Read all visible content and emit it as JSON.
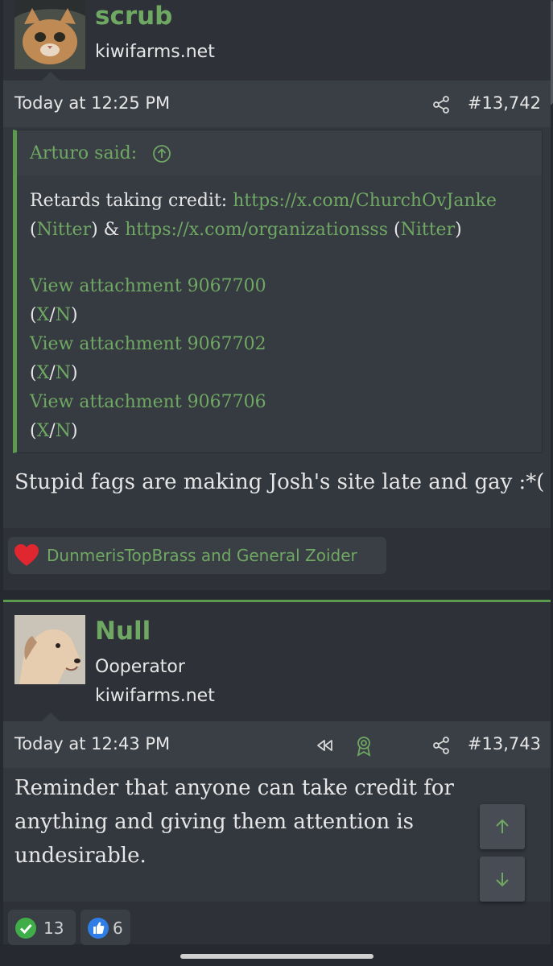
{
  "posts": [
    {
      "username": "scrub",
      "user_title": "kiwifarms.net",
      "date": "Today at 12:25 PM",
      "post_number": "#13,742",
      "quote": {
        "author": "Arturo said:",
        "line1_text": "Retards taking credit: ",
        "line1_link": "https://x.com/ChurchOvJanke",
        "line2_open": "(",
        "line2_nitter1": "Nitter",
        "line2_mid": ") & ",
        "line2_link": "https://x.com/organizationsss",
        "line2_open2": " (",
        "line2_nitter2": "Nitter",
        "line2_close": ")",
        "attachments": [
          {
            "label": "View attachment 9067700",
            "x": "X",
            "n": "N"
          },
          {
            "label": "View attachment 9067702",
            "x": "X",
            "n": "N"
          },
          {
            "label": "View attachment 9067706",
            "x": "X",
            "n": "N"
          }
        ]
      },
      "body": "Stupid fags are making Josh's site late and gay :*(",
      "reactions": "DunmerisTopBrass and General Zoider"
    },
    {
      "username": "Null",
      "user_title": "Ooperator",
      "user_domain": "kiwifarms.net",
      "date": "Today at 12:43 PM",
      "post_number": "#13,743",
      "body_lines": [
        "Reminder that anyone can take credit for",
        "anything and giving them attention is",
        "undesirable."
      ],
      "reaction_counts": [
        {
          "icon": "check-icon",
          "count": "13"
        },
        {
          "icon": "thumbs-up-icon",
          "count": "6"
        }
      ]
    }
  ],
  "colors": {
    "accent": "#6fa863",
    "background": "#262a30",
    "post_background": "#33373e"
  }
}
